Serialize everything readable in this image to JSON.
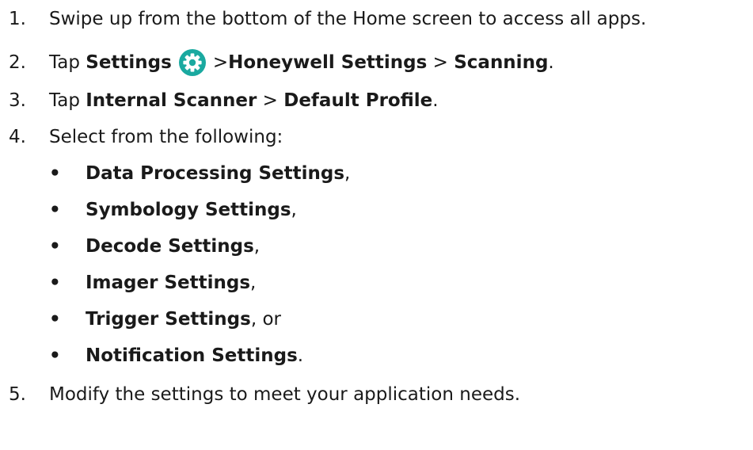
{
  "steps": [
    {
      "number": "1.",
      "text": "Swipe up from the bottom of the Home screen to access all apps."
    },
    {
      "number": "2.",
      "prefix": "Tap ",
      "settings": "Settings",
      "sep1": ">",
      "honeywell": "Honeywell Settings",
      "sep2": " > ",
      "scanning": "Scanning",
      "end": "."
    },
    {
      "number": "3.",
      "prefix": "Tap ",
      "internal": "Internal Scanner",
      "sep": " > ",
      "default_profile": "Default Profile",
      "end": "."
    },
    {
      "number": "4.",
      "text": "Select from the following:"
    },
    {
      "number": "5.",
      "text": "Modify the settings to meet your application needs."
    }
  ],
  "options": [
    {
      "bullet": "•",
      "label": "Data Processing Settings",
      "suffix": ","
    },
    {
      "bullet": "•",
      "label": "Symbology Settings",
      "suffix": ","
    },
    {
      "bullet": "•",
      "label": "Decode Settings",
      "suffix": ","
    },
    {
      "bullet": "•",
      "label": "Imager Settings",
      "suffix": ","
    },
    {
      "bullet": "•",
      "label": "Trigger Settings",
      "suffix": ", or"
    },
    {
      "bullet": "•",
      "label": "Notification Settings",
      "suffix": "."
    }
  ],
  "icons": {
    "settings_icon": "gear-icon",
    "settings_icon_color": "#1aa9a0"
  }
}
